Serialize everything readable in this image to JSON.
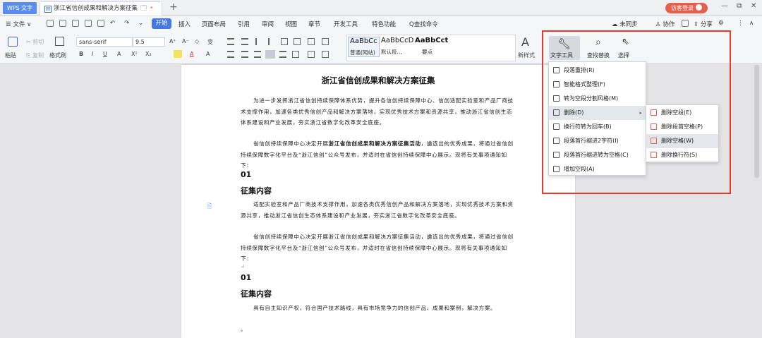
{
  "titlebar": {
    "app_name": "WPS 文字",
    "doc_tab_icon": "W",
    "doc_tab_title": "浙江省信创成果和解决方案征集",
    "tab_extra": "🗔",
    "tab_dot": "•",
    "new_tab": "+",
    "guest_login": "访客登录",
    "minimize": "—",
    "restore": "⧉",
    "close": "✕"
  },
  "menubar": {
    "file_menu": "☰ 文件 ∨",
    "tabs": [
      "开始",
      "插入",
      "页面布局",
      "引用",
      "审阅",
      "视图",
      "章节",
      "开发工具",
      "特色功能"
    ],
    "search_command": "Q查找命令",
    "sync": "未同步",
    "collab": "协作",
    "share": "分享",
    "more": "⋮",
    "collapse": "∧"
  },
  "ribbon": {
    "paste": "粘贴",
    "cut": "剪切",
    "copy": "复制",
    "format_painter": "格式刷",
    "font_name": "sans-serif",
    "font_size": "9.5",
    "grow_font": "A⁺",
    "shrink_font": "A⁻",
    "clear_format": "◇",
    "pinyin": "变",
    "bold": "B",
    "italic": "I",
    "underline": "U",
    "font_color": "A",
    "superscript": "X²",
    "subscript": "X₂",
    "styles": [
      {
        "preview": "AaBbCc",
        "name": "普通(网站)",
        "selected": true
      },
      {
        "preview": "AaBbCcD",
        "name": "默认段...",
        "selected": false
      },
      {
        "preview": "AaBbCct",
        "name": "要点",
        "selected": false
      }
    ],
    "new_style": "新样式",
    "new_style_icon": "A",
    "text_tools": "文字工具",
    "find_replace": "查找替换",
    "select": "选择"
  },
  "document": {
    "title": "浙江省信创成果和解决方案征集",
    "p1": "为进一步发挥浙江省信创持续保障体系优势，提升各信创持续保障中心、信创适配实验室和产品厂商技术支撑作用，加速各类优秀信创产品和解决方案落地，实现优秀技术方案和资源共享，推动浙江省信创生态体系建设和产业发展，夯实浙江省数字化改革安全底座。",
    "p2_a": "省信创持续保障中心决定开展",
    "p2_bold": "浙江省信创成果和解决方案征集活动",
    "p2_b": "，遴选出的优秀成果，将通过省信创持续保障数字化平台及“浙江信创”公众号发布，并适时在省信创持续保障中心展示。现将有关事项通知如下：",
    "h_num_1": "01",
    "h_title_1": "征集内容",
    "p3": "适配实验室和产品厂商技术支撑作用，加速各类优秀信创产品和解决方案落地，实现优秀技术方案和资源共享，推动浙江省信创生态体系建设和产业发展，夯实浙江省数字化改革安全底座。",
    "p4": "省信创持续保障中心决定开展浙江省信创成果和解决方案征集活动，遴选出的优秀成果，将通过省信创持续保障数字化平台及“浙江信创”公众号发布，并适时在省信创持续保障中心展示。现将有关事项通知如下：",
    "h_num_2": "01",
    "h_title_2": "征集内容",
    "p5": "具有自主知识产权，符合国产技术路线，具有市场竞争力的信创产品、成果和案例，解决方案。",
    "p6": "。",
    "pmark": "↵",
    "margin_icon": "🗎"
  },
  "text_tools_menu": [
    {
      "label": "段落重排(R)",
      "has_submenu": false,
      "active": false
    },
    {
      "label": "智能格式整理(F)",
      "has_submenu": false,
      "active": false
    },
    {
      "label": "转为空段分割风格(M)",
      "has_submenu": false,
      "active": false
    },
    {
      "label": "删除(D)",
      "has_submenu": true,
      "active": true
    },
    {
      "label": "换行符转为回车(B)",
      "has_submenu": false,
      "active": false
    },
    {
      "label": "段落首行缩进2字符(I)",
      "has_submenu": false,
      "active": false
    },
    {
      "label": "段落首行缩进转为空格(C)",
      "has_submenu": false,
      "active": false
    },
    {
      "label": "增加空段(A)",
      "has_submenu": false,
      "active": false
    }
  ],
  "delete_submenu": [
    {
      "label": "删除空段(E)",
      "active": false
    },
    {
      "label": "删除段首空格(P)",
      "active": false
    },
    {
      "label": "删除空格(W)",
      "active": true
    },
    {
      "label": "删除换行符(S)",
      "active": false
    }
  ],
  "submenu_arrow": "▸",
  "colors": {
    "highlight_frame": "#e83a2c",
    "accent": "#4477e8",
    "guest": "#e8604c"
  }
}
